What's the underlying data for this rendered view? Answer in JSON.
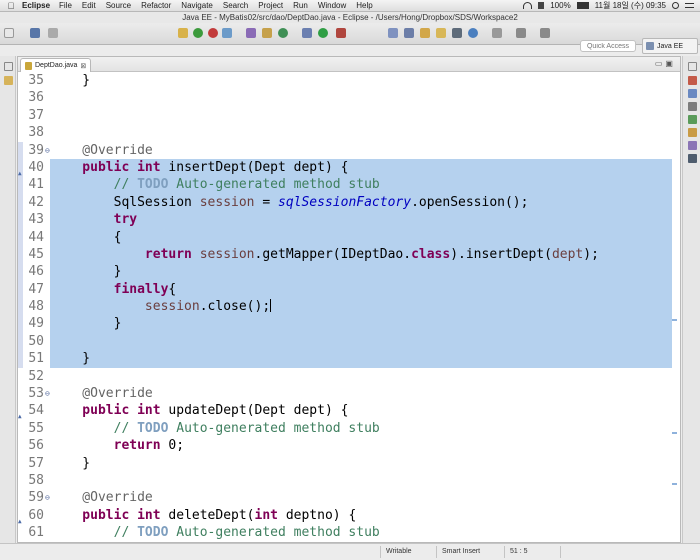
{
  "menubar": {
    "app": "Eclipse",
    "items": [
      "File",
      "Edit",
      "Source",
      "Refactor",
      "Navigate",
      "Search",
      "Project",
      "Run",
      "Window",
      "Help"
    ],
    "battery": "100%",
    "clock": "11월 18일 (수) 09:35"
  },
  "window": {
    "title": "Java EE - MyBatis02/src/dao/DeptDao.java - Eclipse - /Users/Hong/Dropbox/SDS/Workspace2"
  },
  "toolbar": {
    "quick_access_placeholder": "Quick Access",
    "perspective": "Java EE"
  },
  "editor": {
    "tab_label": "DeptDao.java",
    "tab_close": "⊠",
    "lines": [
      {
        "n": "35",
        "segs": [
          [
            "p",
            "    }"
          ]
        ]
      },
      {
        "n": "36",
        "segs": []
      },
      {
        "n": "37",
        "segs": []
      },
      {
        "n": "38",
        "segs": []
      },
      {
        "n": "39",
        "fold": "⊖",
        "segs": [
          [
            "an",
            "    @Override"
          ]
        ]
      },
      {
        "n": "40",
        "ovr": true,
        "segs": [
          [
            "kw",
            "    public"
          ],
          [
            "p",
            " "
          ],
          [
            "kw",
            "int"
          ],
          [
            "p",
            " insertDept(Dept dept) {"
          ]
        ]
      },
      {
        "n": "41",
        "segs": [
          [
            "p",
            "        "
          ],
          [
            "cm",
            "// "
          ],
          [
            "td",
            "TODO"
          ],
          [
            "cm",
            " Auto-generated method stub"
          ]
        ]
      },
      {
        "n": "42",
        "segs": [
          [
            "p",
            "        SqlSession "
          ],
          [
            "var",
            "session"
          ],
          [
            "p",
            " = "
          ],
          [
            "fld",
            "sqlSessionFactory"
          ],
          [
            "p",
            ".openSession();"
          ]
        ]
      },
      {
        "n": "43",
        "segs": [
          [
            "kw",
            "        try"
          ]
        ]
      },
      {
        "n": "44",
        "segs": [
          [
            "p",
            "        {"
          ]
        ]
      },
      {
        "n": "45",
        "segs": [
          [
            "kw",
            "            return"
          ],
          [
            "p",
            " "
          ],
          [
            "var",
            "session"
          ],
          [
            "p",
            ".getMapper(IDeptDao."
          ],
          [
            "kw",
            "class"
          ],
          [
            "p",
            ").insertDept("
          ],
          [
            "var",
            "dept"
          ],
          [
            "p",
            ");"
          ]
        ]
      },
      {
        "n": "46",
        "segs": [
          [
            "p",
            "        }"
          ]
        ]
      },
      {
        "n": "47",
        "segs": [
          [
            "kw",
            "        finally"
          ],
          [
            "p",
            "{"
          ]
        ]
      },
      {
        "n": "48",
        "caret": true,
        "segs": [
          [
            "p",
            "            "
          ],
          [
            "var",
            "session"
          ],
          [
            "p",
            ".close();"
          ]
        ]
      },
      {
        "n": "49",
        "segs": [
          [
            "p",
            "        }"
          ]
        ]
      },
      {
        "n": "50",
        "segs": []
      },
      {
        "n": "51",
        "segs": [
          [
            "p",
            "    }"
          ]
        ]
      },
      {
        "n": "52",
        "segs": []
      },
      {
        "n": "53",
        "fold": "⊖",
        "segs": [
          [
            "an",
            "    @Override"
          ]
        ]
      },
      {
        "n": "54",
        "ovr": true,
        "segs": [
          [
            "kw",
            "    public"
          ],
          [
            "p",
            " "
          ],
          [
            "kw",
            "int"
          ],
          [
            "p",
            " updateDept(Dept dept) {"
          ]
        ]
      },
      {
        "n": "55",
        "segs": [
          [
            "p",
            "        "
          ],
          [
            "cm",
            "// "
          ],
          [
            "td",
            "TODO"
          ],
          [
            "cm",
            " Auto-generated method stub"
          ]
        ]
      },
      {
        "n": "56",
        "segs": [
          [
            "kw",
            "        return"
          ],
          [
            "p",
            " 0;"
          ]
        ]
      },
      {
        "n": "57",
        "segs": [
          [
            "p",
            "    }"
          ]
        ]
      },
      {
        "n": "58",
        "segs": []
      },
      {
        "n": "59",
        "fold": "⊖",
        "segs": [
          [
            "an",
            "    @Override"
          ]
        ]
      },
      {
        "n": "60",
        "ovr": true,
        "segs": [
          [
            "kw",
            "    public"
          ],
          [
            "p",
            " "
          ],
          [
            "kw",
            "int"
          ],
          [
            "p",
            " deleteDept("
          ],
          [
            "kw",
            "int"
          ],
          [
            "p",
            " deptno) {"
          ]
        ]
      },
      {
        "n": "61",
        "segs": [
          [
            "p",
            "        "
          ],
          [
            "cm",
            "// "
          ],
          [
            "td",
            "TODO"
          ],
          [
            "cm",
            " Auto-generated method stub"
          ]
        ]
      }
    ]
  },
  "statusbar": {
    "mode": "Writable",
    "insert": "Smart Insert",
    "position": "51 : 5"
  },
  "colors": {
    "selection": "#b5d1ee",
    "keyword": "#7f0055",
    "comment": "#3f7f5f",
    "field": "#0000c0"
  }
}
